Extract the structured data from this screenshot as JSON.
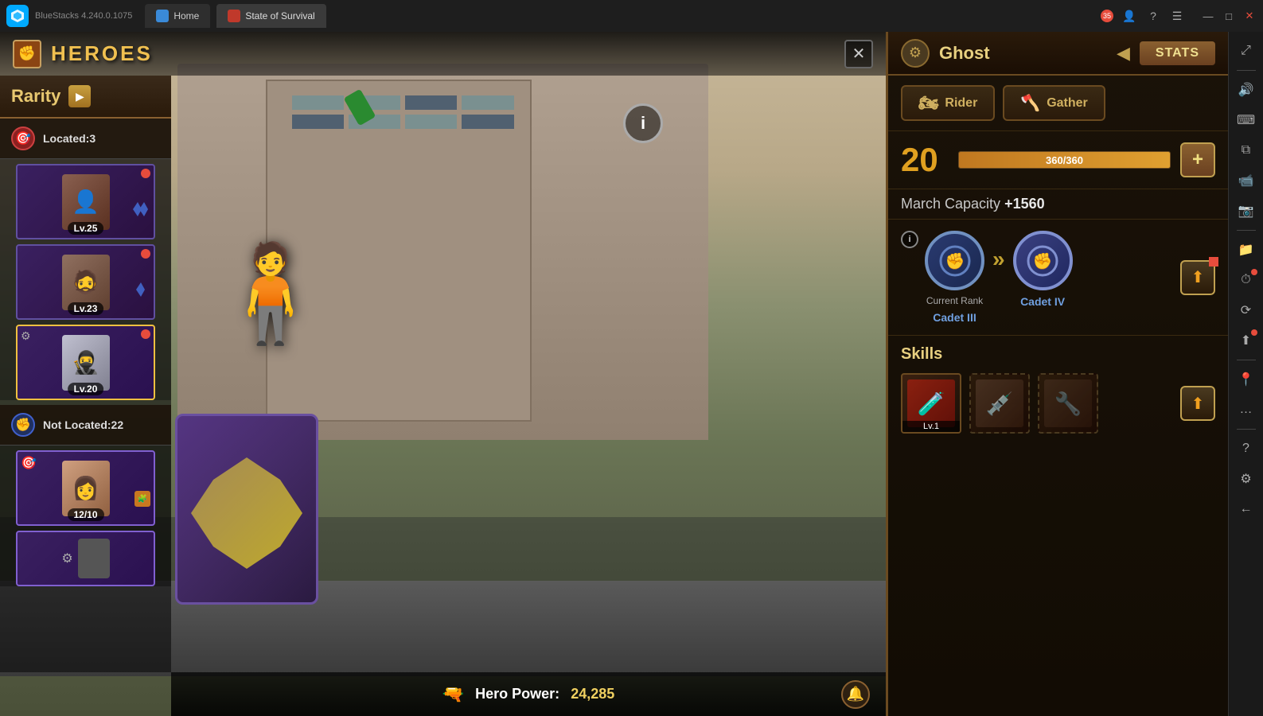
{
  "window": {
    "title": "BlueStacks 4.240.0.1075",
    "tabs": [
      {
        "id": "home",
        "label": "Home",
        "active": false
      },
      {
        "id": "game",
        "label": "State of Survival",
        "active": true
      }
    ],
    "controls": {
      "minimize": "—",
      "maximize": "□",
      "close": "✕"
    },
    "notifications": "35"
  },
  "header": {
    "heroes_title": "HEROES",
    "close_symbol": "✕"
  },
  "rarity_filter": {
    "label": "Rarity",
    "arrow": "▶"
  },
  "located_section": {
    "label": "Located:3",
    "count": 3
  },
  "heroes_located": [
    {
      "id": 1,
      "level": "Lv.25",
      "type": "ranger",
      "has_red_dot": true,
      "rank": "blue-double"
    },
    {
      "id": 2,
      "level": "Lv.23",
      "type": "fighter",
      "has_red_dot": true,
      "rank": "blue-single"
    }
  ],
  "hero_selected": {
    "id": 3,
    "level": "Lv.20",
    "type": "ghost",
    "has_red_dot": true,
    "has_settings": true
  },
  "not_located_section": {
    "label": "Not Located:22",
    "count": 22
  },
  "heroes_not_located": [
    {
      "id": 4,
      "progress": "12/10",
      "type": "female",
      "has_puzzle": true
    }
  ],
  "bottom_bar": {
    "power_label": "Hero Power:",
    "power_value": "24,285"
  },
  "stats_panel": {
    "header": {
      "gear_icon": "⚙",
      "name": "Ghost",
      "nav_left": "◀",
      "tab_label": "STATS"
    },
    "role_tabs": [
      {
        "id": "rider",
        "icon": "🏍",
        "label": "Rider"
      },
      {
        "id": "gather",
        "icon": "🎸",
        "label": "Gather"
      }
    ],
    "level": {
      "number": "20",
      "xp_current": "360",
      "xp_max": "360",
      "xp_display": "360/360",
      "plus_btn": "+"
    },
    "march_capacity": {
      "label": "March Capacity",
      "value": "+1560"
    },
    "rank": {
      "info_icon": "i",
      "current_label": "Current Rank",
      "current_name": "Cadet III",
      "next_name": "Cadet IV",
      "arrows": "»",
      "up_btn": "▲"
    },
    "skills": {
      "title": "Skills",
      "items": [
        {
          "id": 1,
          "icon": "🧪",
          "level": "Lv.1",
          "filled": true
        },
        {
          "id": 2,
          "icon": "💉",
          "filled": false
        },
        {
          "id": 3,
          "icon": "🔧",
          "filled": false
        }
      ],
      "up_btn": "▲"
    }
  },
  "right_sidebar": {
    "icons": [
      {
        "id": "expand",
        "symbol": "⤢"
      },
      {
        "id": "volume",
        "symbol": "🔊"
      },
      {
        "id": "keyboard",
        "symbol": "⌨"
      },
      {
        "id": "copy",
        "symbol": "⧉"
      },
      {
        "id": "video",
        "symbol": "📹"
      },
      {
        "id": "camera",
        "symbol": "📷"
      },
      {
        "id": "location",
        "symbol": "📍"
      },
      {
        "id": "more",
        "symbol": "…"
      },
      {
        "id": "folder",
        "symbol": "📁"
      },
      {
        "id": "timer",
        "symbol": "⏱"
      },
      {
        "id": "sync",
        "symbol": "⟳"
      },
      {
        "id": "up-arrow",
        "symbol": "⬆"
      },
      {
        "id": "question",
        "symbol": "?"
      },
      {
        "id": "settings",
        "symbol": "⚙"
      },
      {
        "id": "back",
        "symbol": "←"
      }
    ]
  }
}
